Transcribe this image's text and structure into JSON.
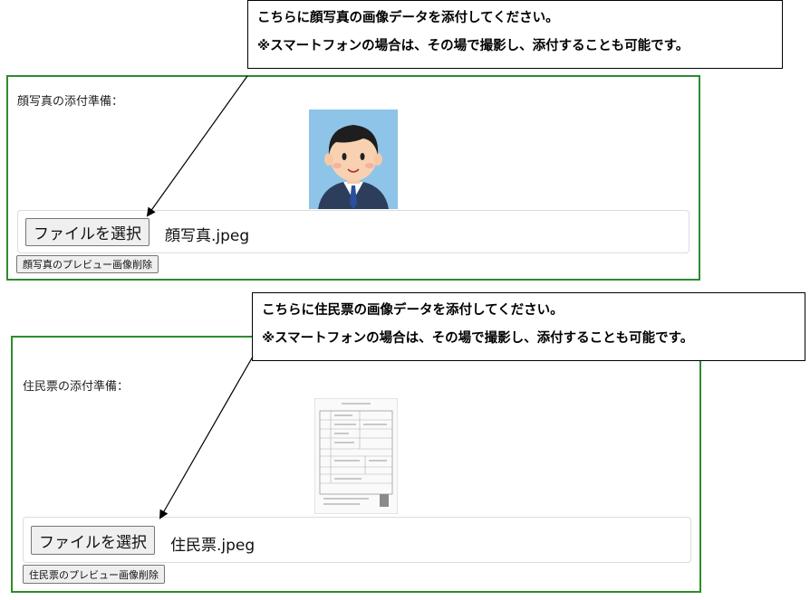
{
  "sections": [
    {
      "label": "顔写真の添付準備：",
      "choose_button": "ファイルを選択",
      "file_name": "顔写真.jpeg",
      "delete_button": "顔写真のプレビュー画像削除",
      "preview_icon": "face-photo-illustration",
      "callout_line1": "こちらに顔写真の画像データを添付してください。",
      "callout_line2": "※スマートフォンの場合は、その場で撮影し、添付することも可能です。"
    },
    {
      "label": "住民票の添付準備：",
      "choose_button": "ファイルを選択",
      "file_name": "住民票.jpeg",
      "delete_button": "住民票のプレビュー画像削除",
      "preview_icon": "resident-record-document",
      "callout_line1": "こちらに住民票の画像データを添付してください。",
      "callout_line2": "※スマートフォンの場合は、その場で撮影し、添付することも可能です。"
    }
  ],
  "colors": {
    "panel_border": "#2e8b2e",
    "button_bg": "#efefef",
    "photo_bg": "#8ec4e8"
  }
}
